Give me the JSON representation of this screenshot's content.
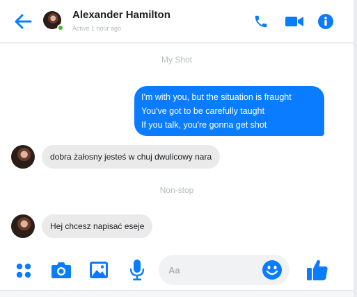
{
  "colors": {
    "accent": "#0a7cff",
    "online": "#42b72a",
    "incoming_bubble": "#eaeaea",
    "divider_text": "#b7bbc0"
  },
  "header": {
    "contact_name": "Alexander Hamilton",
    "status": "Active 1 hour ago",
    "icons": [
      "back-arrow-icon",
      "phone-icon",
      "video-camera-icon",
      "info-icon"
    ]
  },
  "conversation": {
    "divider_1": "My Shot",
    "outgoing": {
      "lines": [
        "I'm with you, but the situation is fraught",
        "You've got to be carefully taught",
        "If you talk, you're gonna get shot"
      ]
    },
    "incoming_1": "dobra żałosny jesteś w chuj dwulicowy nara",
    "divider_2": "Non-stop",
    "incoming_2": "Hej chcesz napisać eseje"
  },
  "composer": {
    "placeholder": "Aa",
    "icons": [
      "more-apps-icon",
      "camera-icon",
      "image-icon",
      "microphone-icon",
      "emoji-icon",
      "thumbs-up-icon"
    ]
  }
}
